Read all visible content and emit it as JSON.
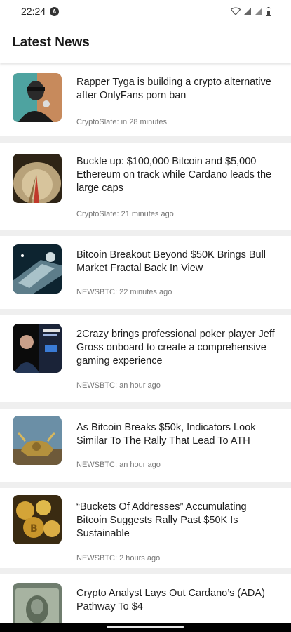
{
  "status_bar": {
    "time": "22:24",
    "app_icon": "A"
  },
  "header": {
    "title": "Latest News"
  },
  "articles": [
    {
      "headline": "Rapper Tyga is building a crypto alternative after OnlyFans porn ban",
      "meta": "CryptoSlate: in 28 minutes",
      "image_icon": "rapper-photo"
    },
    {
      "headline": "Buckle up: $100,000 Bitcoin and $5,000 Ethereum on track while Cardano leads the large caps",
      "meta": "CryptoSlate: 21 minutes ago",
      "image_icon": "tunnel-graphic"
    },
    {
      "headline": "Bitcoin Breakout Beyond $50K Brings Bull Market Fractal Back In View",
      "meta": "NEWSBTC: 22 minutes ago",
      "image_icon": "spaceship-graphic"
    },
    {
      "headline": "2Crazy brings professional poker player Jeff Gross onboard to create a comprehensive gaming experience",
      "meta": "NEWSBTC: an hour ago",
      "image_icon": "person-banner"
    },
    {
      "headline": "As Bitcoin Breaks $50k, Indicators Look Similar To The Rally That Lead To ATH",
      "meta": "NEWSBTC: an hour ago",
      "image_icon": "bull-statue"
    },
    {
      "headline": "“Buckets Of Addresses” Accumulating Bitcoin Suggests Rally Past $50K Is Sustainable",
      "meta": "NEWSBTC: 2 hours ago",
      "image_icon": "bitcoin-coins"
    },
    {
      "headline": "Crypto Analyst Lays Out Cardano’s (ADA) Pathway To $4",
      "meta": "",
      "image_icon": "dollar-bill"
    }
  ]
}
